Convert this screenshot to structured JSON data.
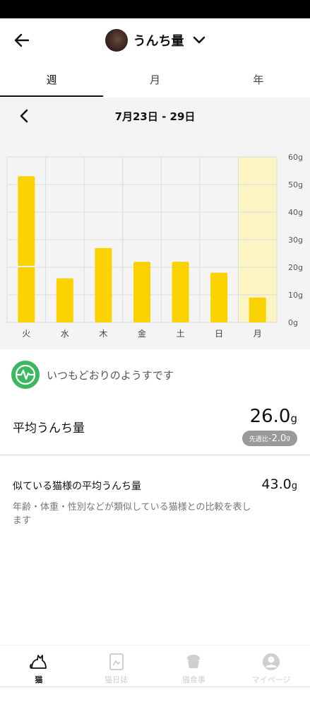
{
  "header": {
    "title": "うんち量"
  },
  "tabs": [
    {
      "label": "週",
      "active": true
    },
    {
      "label": "月",
      "active": false
    },
    {
      "label": "年",
      "active": false
    }
  ],
  "week_nav": {
    "range": "7月23日 - 29日"
  },
  "chart_data": {
    "type": "bar",
    "categories": [
      "火",
      "水",
      "木",
      "金",
      "土",
      "日",
      "月"
    ],
    "series": [
      {
        "values": [
          20,
          16,
          27,
          22,
          22,
          18,
          9
        ]
      },
      {
        "values": [
          33,
          0,
          0,
          0,
          0,
          0,
          0
        ]
      }
    ],
    "stacked": true,
    "y_ticks": [
      "0g",
      "10g",
      "20g",
      "30g",
      "40g",
      "50g",
      "60g"
    ],
    "ylim": [
      0,
      60
    ],
    "highlight_category": "月",
    "colors": {
      "bar": "#f9d200",
      "highlight_bg": "#fdf4c4",
      "grid": "#dcdcdc"
    }
  },
  "status": {
    "text": "いつもどおりのようすです",
    "color": "#3cb860"
  },
  "average": {
    "label": "平均うんち量",
    "value": "26.0",
    "unit": "g",
    "diff_label": "先週比",
    "diff_value": "-2.0",
    "diff_unit": "g"
  },
  "similar": {
    "title": "似ている猫様の平均うんち量",
    "value": "43.0",
    "unit": "g",
    "description": "年齢・体重・性別などが類似している猫様との比較を表します"
  },
  "bottom_nav": [
    {
      "label": "猫",
      "icon": "cat-icon",
      "active": true
    },
    {
      "label": "猫日誌",
      "icon": "diary-icon",
      "active": false
    },
    {
      "label": "猫食事",
      "icon": "food-bowl-icon",
      "active": false
    },
    {
      "label": "マイページ",
      "icon": "profile-icon",
      "active": false
    }
  ]
}
